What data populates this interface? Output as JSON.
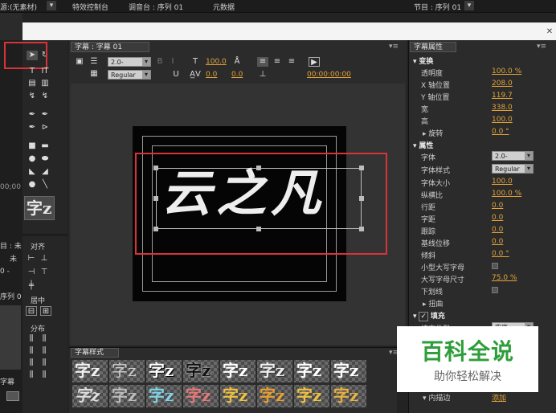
{
  "top_bar": {
    "source_tab": "源:(无素材)",
    "effect_controls_tab": "特效控制台",
    "mixer_tab": "调音台 : 序列 01",
    "metadata_tab": "元数据",
    "timeline_tab": "节目 : 序列 01"
  },
  "title_panel": {
    "tab_label": "字幕 : 字幕 01",
    "font_size": "2.0-",
    "font_style": "Regular",
    "size_value": "100.0",
    "kerning_value": "0.0",
    "leading_value": "0.0",
    "timecode": "00:00:00:00",
    "canvas_text": "云之凡"
  },
  "left_panel": {
    "timecode_partial": "00;00",
    "glyph_preview": "字z",
    "side_labels": [
      "目 : 未",
      "未",
      "0 -",
      "序列 0",
      "字幕"
    ],
    "align_label": "对齐",
    "center_label": "居中",
    "distribute_label": "分布"
  },
  "props_panel": {
    "tab_label": "字幕属性",
    "sections": {
      "transform": "变换",
      "properties": "属性",
      "fill": "填充"
    },
    "transform_rows": [
      {
        "label": "透明度",
        "value": "100.0 %"
      },
      {
        "label": "X 轴位置",
        "value": "208.0"
      },
      {
        "label": "Y 轴位置",
        "value": "119.7"
      },
      {
        "label": "宽",
        "value": "338.0"
      },
      {
        "label": "高",
        "value": "100.0"
      },
      {
        "label": "旋转",
        "value": "0.0 °"
      }
    ],
    "property_rows": [
      {
        "label": "字体",
        "value": "2.0-"
      },
      {
        "label": "字体样式",
        "value": "Regular"
      },
      {
        "label": "字体大小",
        "value": "100.0"
      },
      {
        "label": "纵横比",
        "value": "100.0 %"
      },
      {
        "label": "行距",
        "value": "0.0"
      },
      {
        "label": "字距",
        "value": "0.0"
      },
      {
        "label": "跟踪",
        "value": "0.0"
      },
      {
        "label": "基线位移",
        "value": "0.0"
      },
      {
        "label": "倾斜",
        "value": "0.0 °"
      },
      {
        "label": "小型大写字母",
        "value": ""
      },
      {
        "label": "大写字母尺寸",
        "value": "75.0 %"
      },
      {
        "label": "下划线",
        "value": ""
      },
      {
        "label": "扭曲",
        "value": ""
      }
    ],
    "fill_rows": [
      {
        "label": "填充类型",
        "value": "实底"
      },
      {
        "label": "内描边",
        "value": "添加"
      }
    ]
  },
  "styles_panel": {
    "tab_label": "字幕样式",
    "thumb_glyph": "字z"
  },
  "watermark": {
    "title": "百科全说",
    "subtitle": "助你轻松解决"
  },
  "colors": {
    "highlight_red": "#d9333a",
    "accent_gold": "#e2a33a",
    "watermark_green": "#2e9e3a"
  }
}
